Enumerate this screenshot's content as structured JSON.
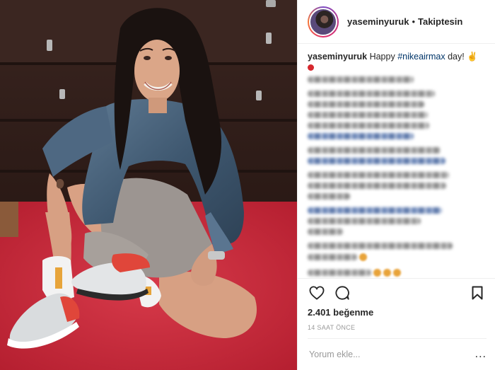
{
  "header": {
    "username": "yaseminyuruk",
    "separator": "•",
    "follow_status": "Takiptesin"
  },
  "caption": {
    "username": "yaseminyuruk",
    "text_before": "Happy",
    "hashtag": "#nikeairmax",
    "text_after": "day! ✌"
  },
  "footer": {
    "likes": "2.401 beğenme",
    "timestamp": "14 SAAT ÖNCE",
    "comment_placeholder": "Yorum ekle...",
    "more_options": "..."
  },
  "icons": {
    "like": "heart-icon",
    "comment": "comment-icon",
    "save": "bookmark-icon"
  },
  "colors": {
    "hashtag": "#003569",
    "carpet": "#c8283a",
    "text": "#262626",
    "muted": "#999999"
  }
}
